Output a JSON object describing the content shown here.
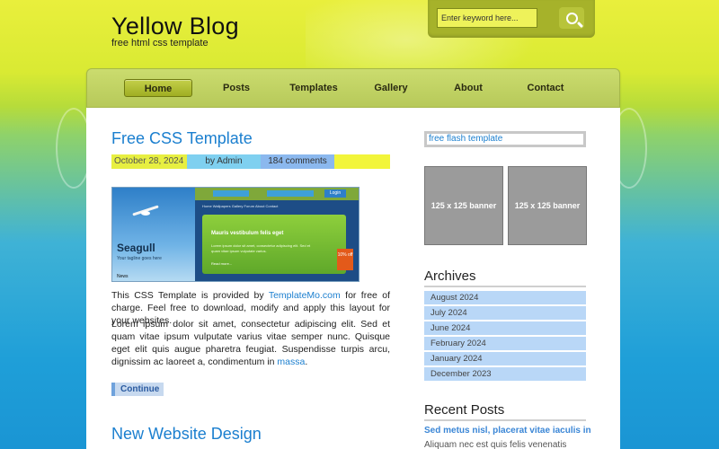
{
  "site": {
    "title": "Yellow Blog",
    "tagline": "free html css template"
  },
  "search": {
    "placeholder": "Enter keyword here...",
    "value": "Enter keyword here..."
  },
  "nav": {
    "items": [
      {
        "label": "Home",
        "active": true
      },
      {
        "label": "Posts",
        "active": false
      },
      {
        "label": "Templates",
        "active": false
      },
      {
        "label": "Gallery",
        "active": false
      },
      {
        "label": "About",
        "active": false
      },
      {
        "label": "Contact",
        "active": false
      }
    ]
  },
  "posts": [
    {
      "title": "Free CSS Template",
      "date": "October 28, 2024",
      "author": "by Admin",
      "comments": "184 comments",
      "image": {
        "bird_caption": "Seagull",
        "bird_sub": "Your tagline goes here",
        "news_label": "News",
        "field_label_1": "Username",
        "field_label_2": "Password",
        "login_label": "Login",
        "menu_text": "Home   Wallpapers   Gallery   Forum   About   Contact",
        "panel_title": "Mauris vestibulum felis eget",
        "panel_text": "Lorem ipsum dolor sit amet, consectetur adipiscing elit. Sed et quam vitae ipsum vulputate varius.",
        "panel_more": "Read more...",
        "badge": "10% off"
      },
      "para1_before": "This CSS Template is provided by ",
      "para1_link": "TemplateMo.com",
      "para1_after": " for free of charge. Feel free to download, modify and apply this layout for your websites.",
      "para2_before": "Lorem ipsum dolor sit amet, consectetur adipiscing elit. Sed et quam vitae ipsum vulputate varius vitae semper nunc. Quisque eget elit quis augue pharetra feugiat. Suspendisse turpis arcu, dignissim ac laoreet a, condimentum in ",
      "para2_link": "massa",
      "para2_after": ".",
      "continue_label": "Continue"
    },
    {
      "title": "New Website Design"
    }
  ],
  "sidebar": {
    "flash_link": "free flash template",
    "banners": [
      "125 x 125 banner",
      "125 x 125 banner"
    ],
    "archives": {
      "heading": "Archives",
      "items": [
        "August 2024",
        "July 2024",
        "June 2024",
        "February 2024",
        "January 2024",
        "December 2023"
      ]
    },
    "recent": {
      "heading": "Recent Posts",
      "first_title": "Sed metus nisl, placerat vitae iaculis in",
      "first_text": "Aliquam nec est quis felis venenatis"
    }
  },
  "colors": {
    "link": "#1b7fcf",
    "nav_active": "#9fad22",
    "archive_bg": "#b9d7f7",
    "meta_date": "#e7ef41",
    "meta_author": "#7fd0f0",
    "meta_comments": "#8bb8ee"
  }
}
